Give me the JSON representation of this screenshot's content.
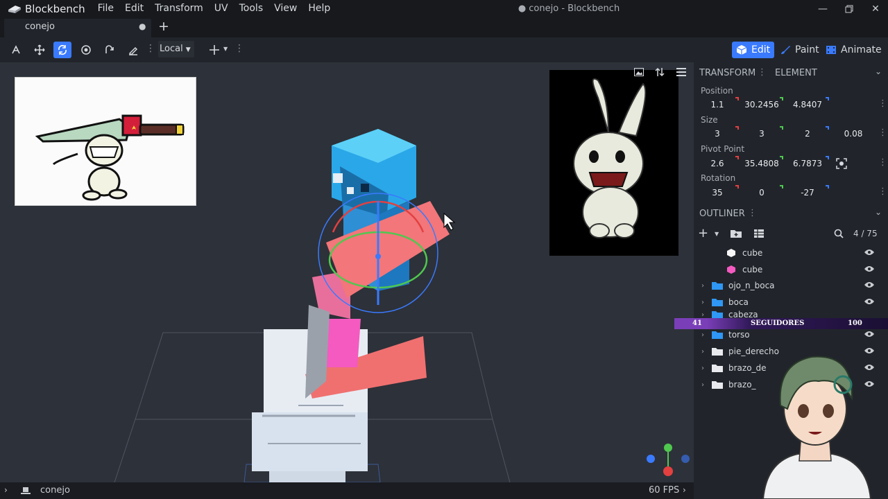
{
  "app": {
    "name": "Blockbench",
    "menu": [
      "File",
      "Edit",
      "Transform",
      "UV",
      "Tools",
      "View",
      "Help"
    ],
    "doc_title": "● conejo - Blockbench",
    "window_controls": [
      "minimize-icon",
      "restore-icon",
      "close-icon"
    ]
  },
  "tab": {
    "label": "conejo",
    "unsaved_dot": "●",
    "new_tab": "+"
  },
  "toolbar": {
    "tools": [
      "move-icon",
      "resize-icon",
      "rotate-icon",
      "pivot-icon",
      "vertex-snap-icon",
      "brush-icon"
    ],
    "active_tool": "rotate-icon",
    "space_label": "Local"
  },
  "modes": [
    {
      "label": "Edit",
      "icon": "cube-icon",
      "active": true
    },
    {
      "label": "Paint",
      "icon": "brush-icon",
      "active": false
    },
    {
      "label": "Animate",
      "icon": "film-icon",
      "active": false
    }
  ],
  "transform": {
    "tab_transform": "TRANSFORM",
    "tab_element": "ELEMENT",
    "position_label": "Position",
    "position": [
      "1.1",
      "30.2456",
      "4.8407"
    ],
    "size_label": "Size",
    "size": [
      "3",
      "3",
      "2",
      "0.08"
    ],
    "pivot_label": "Pivot Point",
    "pivot": [
      "2.6",
      "35.4808",
      "6.7873"
    ],
    "rotation_label": "Rotation",
    "rotation": [
      "35",
      "0",
      "-27"
    ]
  },
  "outliner": {
    "title": "OUTLINER",
    "count": "4 / 75",
    "rows": [
      {
        "label": "cube",
        "type": "cube",
        "color": "#f7f7f7"
      },
      {
        "label": "cube",
        "type": "cube",
        "color": "#f45ac0"
      },
      {
        "label": "ojo_n_boca",
        "type": "group"
      },
      {
        "label": "boca",
        "type": "group"
      },
      {
        "label": "cabeza",
        "type": "group"
      },
      {
        "label": "torso",
        "type": "group"
      },
      {
        "label": "pie_derecho",
        "type": "group"
      },
      {
        "label": "brazo_de",
        "type": "group"
      },
      {
        "label": "brazo_",
        "type": "group"
      }
    ]
  },
  "overlay": {
    "left": "41",
    "center": "SEGUIDORES",
    "right": "100"
  },
  "status": {
    "project": "conejo",
    "fps": "60 FPS"
  },
  "colors": {
    "accent": "#3a7afe",
    "x_axis": "#e34040",
    "y_axis": "#4fc84f",
    "z_axis": "#3a7afe",
    "folder": "#2f97f5"
  }
}
